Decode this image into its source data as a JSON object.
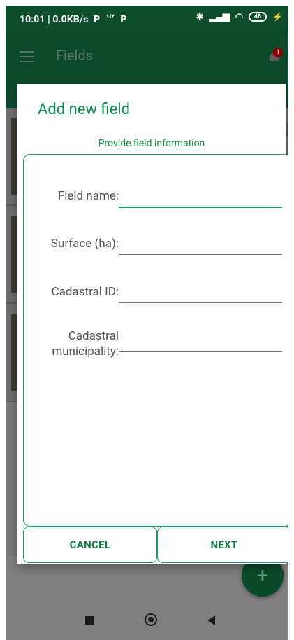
{
  "status_bar": {
    "time_speed": "10:01 | 0.0KB/s",
    "p_letter_1": "P",
    "p_letter_2": "P",
    "battery": "48"
  },
  "app_bar": {
    "title": "Fields",
    "notification_count": "1"
  },
  "dialog": {
    "title": "Add new field",
    "subtitle": "Provide field information",
    "fields": [
      {
        "label": "Field name:",
        "value": ""
      },
      {
        "label": "Surface (ha):",
        "value": ""
      },
      {
        "label": "Cadastral ID:",
        "value": ""
      },
      {
        "label_line1": "Cadastral",
        "label_line2": "municipality:",
        "value": ""
      }
    ],
    "cancel_label": "CANCEL",
    "next_label": "NEXT"
  },
  "fab_label": "+",
  "colors": {
    "primary": "#0b8b4e",
    "app_bar_dim": "#0c4a2b",
    "accent_border": "#1b9b67"
  }
}
